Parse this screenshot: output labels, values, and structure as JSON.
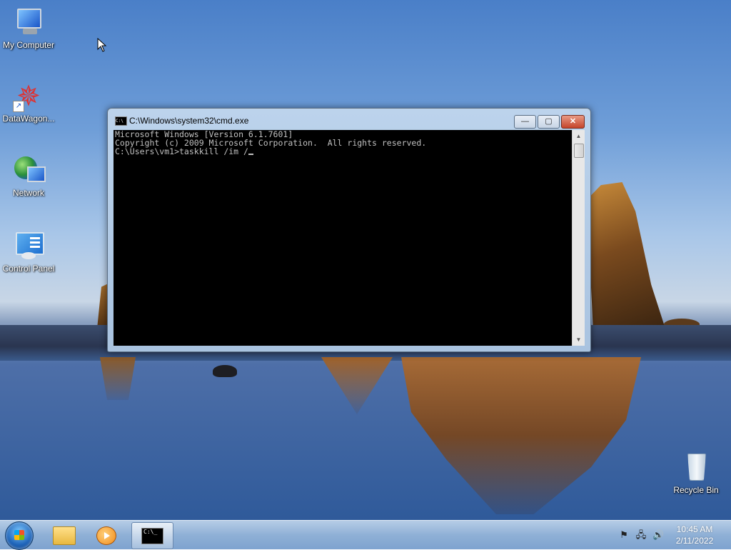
{
  "desktop": {
    "icons": [
      {
        "label": "My Computer"
      },
      {
        "label": "DataWagon..."
      },
      {
        "label": "Network"
      },
      {
        "label": "Control Panel"
      },
      {
        "label": "Recycle Bin"
      }
    ]
  },
  "cmd_window": {
    "title": "C:\\Windows\\system32\\cmd.exe",
    "icon_text": "C:\\",
    "buttons": {
      "minimize": "—",
      "maximize": "▢",
      "close": "✕"
    },
    "console_lines": [
      "Microsoft Windows [Version 6.1.7601]",
      "Copyright (c) 2009 Microsoft Corporation.  All rights reserved.",
      "",
      "C:\\Users\\vm1>taskkill /im /"
    ]
  },
  "taskbar": {
    "pinned": [
      {
        "name": "windows-explorer-icon"
      },
      {
        "name": "windows-media-player-icon"
      },
      {
        "name": "command-prompt-icon",
        "text": "C:\\_"
      }
    ],
    "tray": {
      "icons": [
        "action-center-flag-icon",
        "network-icon",
        "volume-icon"
      ],
      "time": "10:45 AM",
      "date": "2/11/2022"
    }
  },
  "colors": {
    "console_bg": "#000000",
    "console_text": "#c0c0c0",
    "close_button": "#c5452b"
  }
}
